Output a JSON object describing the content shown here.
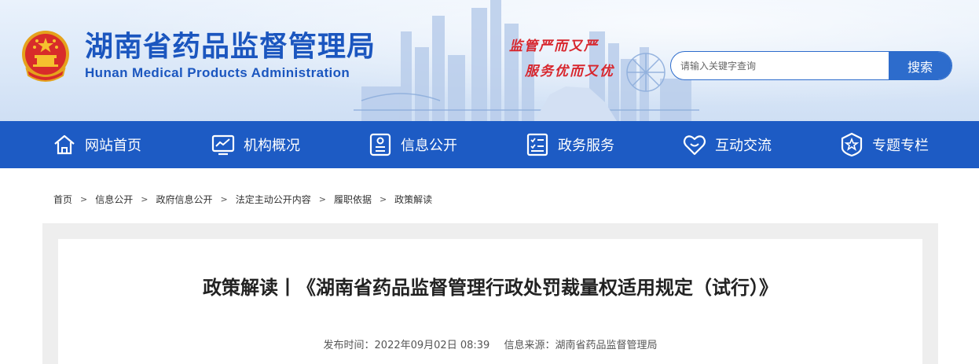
{
  "header": {
    "title": "湖南省药品监督管理局",
    "subtitle": "Hunan Medical Products Administration",
    "slogan_line1": "监管严而又严",
    "slogan_line2": "服务优而又优",
    "search": {
      "placeholder": "请输入关键字查询",
      "button_label": "搜索"
    }
  },
  "nav": {
    "items": [
      {
        "label": "网站首页",
        "icon": "home-icon"
      },
      {
        "label": "机构概况",
        "icon": "chart-monitor-icon"
      },
      {
        "label": "信息公开",
        "icon": "info-card-icon"
      },
      {
        "label": "政务服务",
        "icon": "checklist-icon"
      },
      {
        "label": "互动交流",
        "icon": "heart-chat-icon"
      },
      {
        "label": "专题专栏",
        "icon": "star-badge-icon"
      }
    ]
  },
  "breadcrumb": {
    "items": [
      "首页",
      "信息公开",
      "政府信息公开",
      "法定主动公开内容",
      "履职依据",
      "政策解读"
    ],
    "separator": ">"
  },
  "article": {
    "title": "政策解读丨《湖南省药品监督管理行政处罚裁量权适用规定（试行）》",
    "publish_time": "发布时间：2022年09月02日 08:39",
    "source": "信息来源：湖南省药品监督管理局"
  },
  "colors": {
    "brand_blue": "#1d5bc4",
    "title_blue": "#1b56bf",
    "slogan_red": "#d8262d"
  }
}
